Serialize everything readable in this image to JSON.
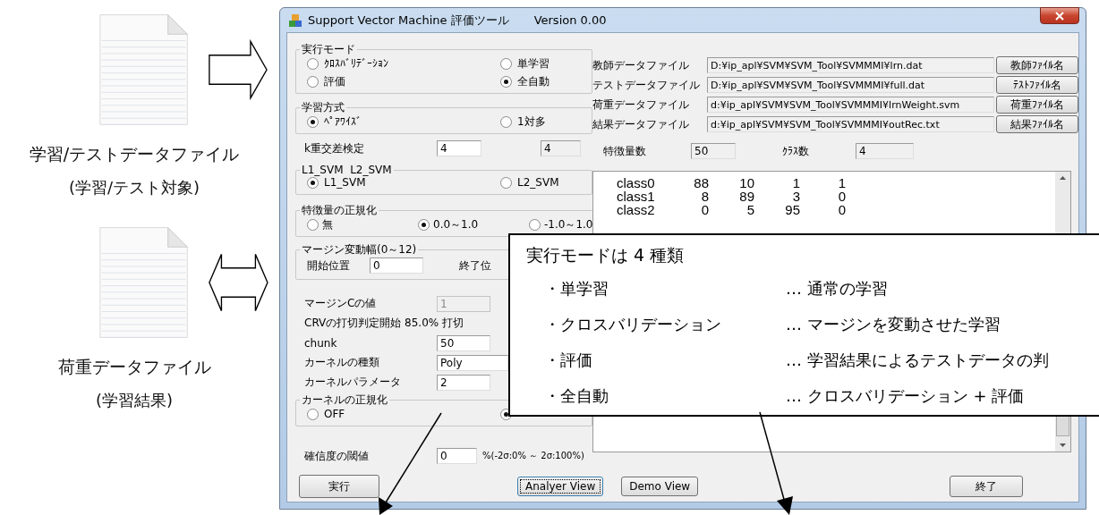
{
  "documents": [
    {
      "title": "学習/テストデータファイル",
      "note": "(学習/テスト対象)",
      "kind": "right"
    },
    {
      "title": "荷重データファイル",
      "note": "(学習結果)",
      "kind": "both"
    }
  ],
  "window": {
    "title": "Support Vector Machine 評価ツール",
    "version": "Version 0.00"
  },
  "exec_mode": {
    "label": "実行モード",
    "options": [
      {
        "label": "ｸﾛｽﾊﾞﾘﾃﾞｰｼｮﾝ",
        "selected": false
      },
      {
        "label": "単学習",
        "selected": false
      },
      {
        "label": "評価",
        "selected": false
      },
      {
        "label": "全自動",
        "selected": true
      }
    ]
  },
  "learning_method": {
    "label": "学習方式",
    "options": [
      {
        "label": "ﾍﾟｱﾜｲｽﾞ",
        "selected": true
      },
      {
        "label": "1対多",
        "selected": false
      }
    ]
  },
  "k_fold": {
    "label": "k重交差検定",
    "value": "4",
    "readout": "4"
  },
  "svm_type": {
    "label": "L1_SVM  L2_SVM",
    "options": [
      {
        "label": "L1_SVM",
        "selected": true
      },
      {
        "label": "L2_SVM",
        "selected": false
      }
    ]
  },
  "normalization": {
    "label": "特徴量の正規化",
    "options": [
      {
        "label": "無",
        "selected": false
      },
      {
        "label": "0.0～1.0",
        "selected": true
      },
      {
        "label": "-1.0～1.0",
        "selected": false
      }
    ]
  },
  "margin_range": {
    "label": "マージン変動幅(0～12)",
    "start_label": "開始位置",
    "start_value": "0",
    "end_label": "終了位"
  },
  "params": [
    {
      "kind": "field",
      "label": "マージンCの値",
      "value": "1",
      "disabled": true
    },
    {
      "kind": "text",
      "label": "CRVの打切判定開始 85.0% 打切"
    },
    {
      "kind": "field",
      "label": "chunk",
      "value": "50",
      "disabled": false
    },
    {
      "kind": "combo",
      "label": "カーネルの種類",
      "value": "Poly"
    },
    {
      "kind": "field",
      "label": "カーネルパラメータ",
      "value": "2",
      "disabled": false
    }
  ],
  "kernel_norm": {
    "label": "カーネルの正規化",
    "options": [
      {
        "label": "OFF",
        "selected": false
      },
      {
        "selected": true
      }
    ]
  },
  "confidence": {
    "label": "確信度の閾値",
    "value": "0",
    "hint": "%(-2σ:0% ～ 2σ:100%)"
  },
  "files": [
    {
      "label": "教師データファイル",
      "value": "D:¥ip_apl¥SVM¥SVM_Tool¥SVMMMI¥lrn.dat",
      "button": "教師ﾌｧｲﾙ名"
    },
    {
      "label": "テストデータファイル",
      "value": "D:¥ip_apl¥SVM¥SVM_Tool¥SVMMMI¥full.dat",
      "button": "ﾃｽﾄﾌｧｲﾙ名"
    },
    {
      "label": "荷重データファイル",
      "value": "d:¥ip_apl¥SVM¥SVM_Tool¥SVMMMI¥lrnWeight.svm",
      "button": "荷重ﾌｧｲﾙ名"
    },
    {
      "label": "結果データファイル",
      "value": "d:¥ip_apl¥SVM¥SVM_Tool¥SVMMMI¥outRec.txt",
      "button": "結果ﾌｧｲﾙ名"
    }
  ],
  "features": {
    "label": "特徴量数",
    "value": "50"
  },
  "classes": {
    "label": "ｸﾗｽ数",
    "value": "4"
  },
  "result_rows": [
    {
      "name": "class0",
      "values": [
        "88",
        "10",
        "1",
        "1"
      ]
    },
    {
      "name": "class1",
      "values": [
        "8",
        "89",
        "3",
        "0"
      ]
    },
    {
      "name": "class2",
      "values": [
        "0",
        "5",
        "95",
        "0"
      ]
    }
  ],
  "run_button": "実行",
  "view_buttons": [
    {
      "label": "Analyer View",
      "focused": true
    },
    {
      "label": "Demo View",
      "focused": false
    }
  ],
  "exit_button": "終了",
  "callout": {
    "title": "実行モードは 4 種類",
    "items": [
      {
        "term": "・単学習",
        "description": "… 通常の学習"
      },
      {
        "term": "・クロスバリデーション",
        "description": "… マージンを変動させた学習"
      },
      {
        "term": "・評価",
        "description": "… 学習結果によるテストデータの判"
      },
      {
        "term": "・全自動",
        "description": "… クロスバリデーション + 評価"
      }
    ]
  }
}
